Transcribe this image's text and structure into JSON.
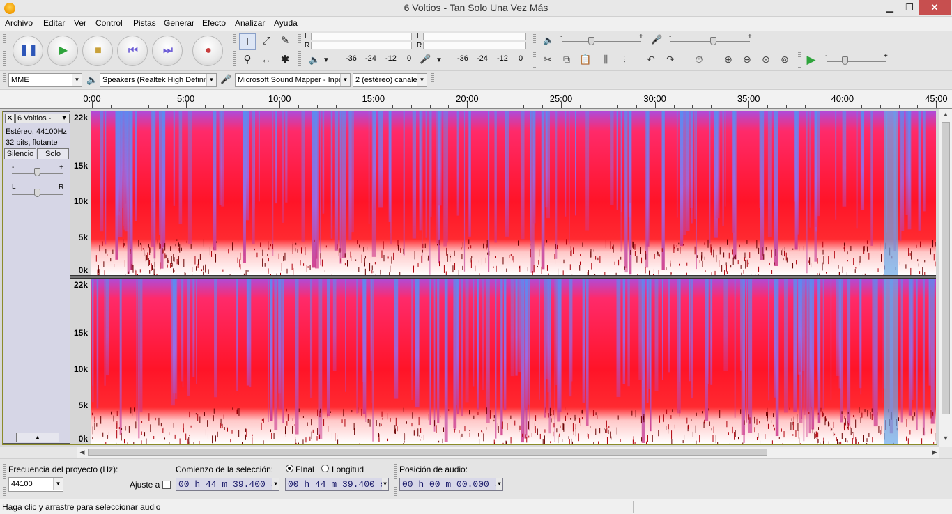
{
  "window": {
    "title": "6 Voltios - Tan Solo Una Vez Más",
    "minimize": "▁",
    "maximize": "❐",
    "close": "✕"
  },
  "menu": [
    "Archivo",
    "Editar",
    "Ver",
    "Control",
    "Pistas",
    "Generar",
    "Efecto",
    "Analizar",
    "Ayuda"
  ],
  "transport": [
    {
      "name": "pause-button",
      "glyph": "❚❚",
      "color": "#2d56b8"
    },
    {
      "name": "play-button",
      "glyph": "▶",
      "color": "#2fa43c"
    },
    {
      "name": "stop-button",
      "glyph": "■",
      "color": "#c9a13a"
    },
    {
      "name": "skip-start-button",
      "glyph": "⏮",
      "color": "#6b5bd6"
    },
    {
      "name": "skip-end-button",
      "glyph": "⏭",
      "color": "#6b5bd6"
    },
    {
      "name": "record-button",
      "glyph": "●",
      "color": "#c73c3c"
    }
  ],
  "tools": {
    "selection": "I",
    "envelope": "⤢",
    "draw": "✎",
    "zoom": "⚲",
    "timeshift": "↔",
    "multi": "✱"
  },
  "meters": {
    "left": "L",
    "right": "R",
    "playback_ticks": [
      "-36",
      "-24",
      "-12",
      "0"
    ],
    "record_ticks": [
      "-36",
      "-24",
      "-12",
      "0"
    ]
  },
  "mixer": {
    "plus": "+",
    "minus": "-"
  },
  "edit_icons": [
    "cut-icon",
    "copy-icon",
    "paste-icon",
    "trim-icon",
    "silence-icon",
    "undo-icon",
    "redo-icon",
    "sync-lock-icon",
    "zoom-in-icon",
    "zoom-out-icon",
    "fit-selection-icon",
    "fit-project-icon"
  ],
  "device": {
    "host": "MME",
    "output": "Speakers (Realtek High Definit",
    "input": "Microsoft Sound Mapper - Inpu",
    "channels": "2 (estéreo) canale"
  },
  "timeline": {
    "labels": [
      "0:00",
      "5:00",
      "10:00",
      "15:00",
      "20:00",
      "25:00",
      "30:00",
      "35:00",
      "40:00",
      "45:00"
    ]
  },
  "track": {
    "name": "6 Voltios -",
    "info_line1": "Estéreo, 44100Hz",
    "info_line2": "32 bits, flotante",
    "mute_label": "Silencio",
    "solo_label": "Solo",
    "gain_minus": "-",
    "gain_plus": "+",
    "pan_left": "L",
    "pan_right": "R",
    "freq_labels": [
      "22k",
      "15k",
      "10k",
      "5k",
      "0k"
    ]
  },
  "selection_bar": {
    "rate_label": "Frecuencia del proyecto (Hz):",
    "rate_value": "44100",
    "snap_label": "Ajuste a",
    "selection_start_label": "Comienzo de la selección:",
    "end_label": "FInal",
    "length_label": "Longitud",
    "start_time": "00 h 44 m 39.400 s",
    "end_time": "00 h 44 m 39.400 s",
    "audio_position_label": "Posición de audio:",
    "audio_position": "00 h 00 m 00.000 s"
  },
  "status": {
    "text": "Haga clic y arrastre para seleccionar audio"
  }
}
